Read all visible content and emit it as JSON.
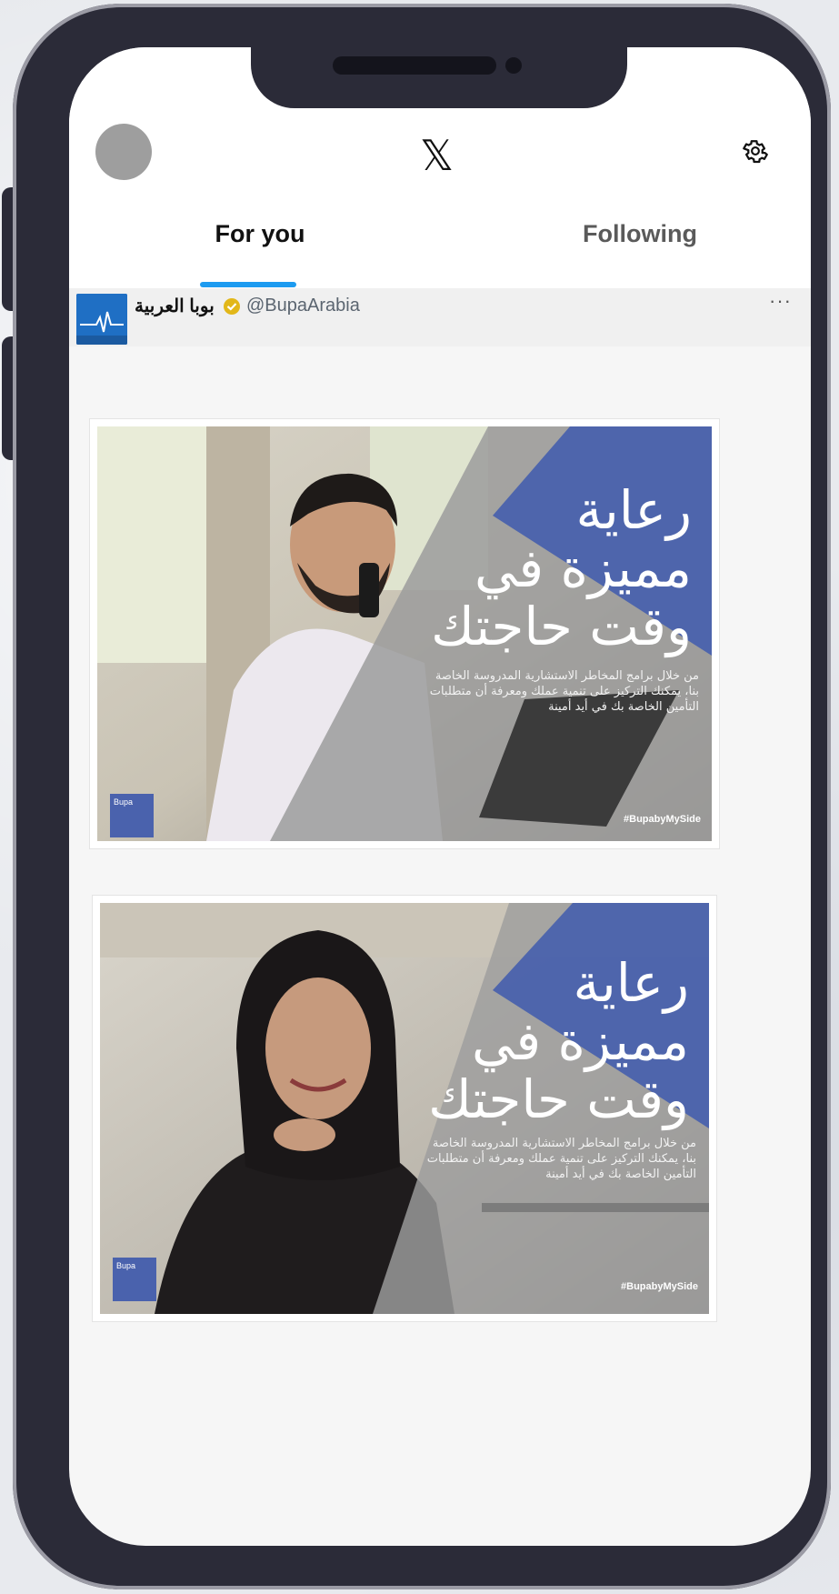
{
  "header": {
    "logo": "𝕏",
    "tabs": [
      {
        "label": "For you",
        "active": true
      },
      {
        "label": "Following",
        "active": false
      }
    ]
  },
  "tweet": {
    "display_name": "بوبا العربية",
    "verified": true,
    "handle": "@BupaArabia",
    "more": "···",
    "images": [
      {
        "title": "رعاية\nمميزة في\nوقت حاجتك",
        "body": "من خلال برامج المخاطر الاستشارية المدروسة الخاصة بنا، يمكنك التركيز على تنمية عملك ومعرفة أن متطلبات التأمين الخاصة بك في أيد أمينة",
        "hashtag": "#BupabyMySide",
        "logo_text": "Bupa"
      },
      {
        "title": "رعاية\nمميزة في\nوقت حاجتك",
        "body": "من خلال برامج المخاطر الاستشارية المدروسة الخاصة بنا، يمكنك التركيز على تنمية عملك ومعرفة أن متطلبات التأمين الخاصة بك في أيد أمينة",
        "hashtag": "#BupabyMySide",
        "logo_text": "Bupa"
      }
    ]
  },
  "colors": {
    "accent": "#1d9bf0",
    "brand_blue": "#4a62ad",
    "verified_gold": "#e2b719"
  }
}
